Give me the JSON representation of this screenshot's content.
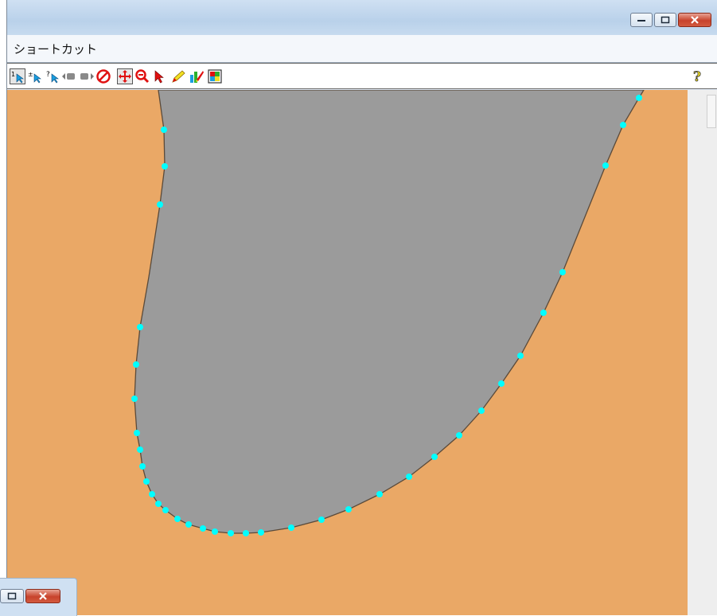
{
  "menubar": {
    "shortcut_label": "ショートカット"
  },
  "toolbar": {
    "items": [
      {
        "name": "select-1-tool",
        "glyph": "¹↖"
      },
      {
        "name": "select-toggle-tool",
        "glyph": "±↖"
      },
      {
        "name": "query-tool",
        "glyph": "?↖"
      },
      {
        "name": "previous-extent",
        "glyph": "◀■"
      },
      {
        "name": "next-extent",
        "glyph": "■▶"
      },
      {
        "name": "no-entry-tool",
        "glyph": "⊘"
      },
      {
        "name": "pan-tool",
        "glyph": "✛"
      },
      {
        "name": "zoom-tool",
        "glyph": "🔍"
      },
      {
        "name": "pointer-tool",
        "glyph": "↖"
      },
      {
        "name": "pencil-tool",
        "glyph": "✎"
      },
      {
        "name": "edit-tool",
        "glyph": "✐"
      },
      {
        "name": "map-tool",
        "glyph": "▦"
      }
    ],
    "help_glyph": "?"
  },
  "colors": {
    "land": "#eaa866",
    "polygon_fill": "#9b9b9b",
    "polygon_stroke": "#5a4a3a",
    "vertex": "#00ffff"
  }
}
